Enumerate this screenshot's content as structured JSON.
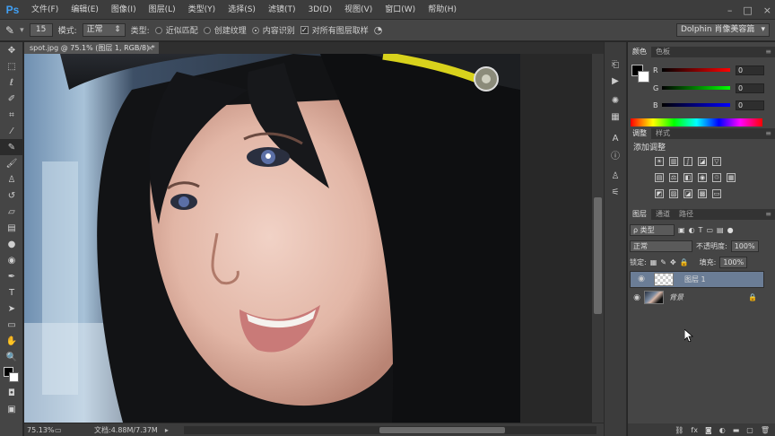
{
  "app": {
    "logo": "Ps"
  },
  "menu": [
    "文件(F)",
    "编辑(E)",
    "图像(I)",
    "图层(L)",
    "类型(Y)",
    "选择(S)",
    "滤镜(T)",
    "3D(D)",
    "视图(V)",
    "窗口(W)",
    "帮助(H)"
  ],
  "window_controls": [
    "–",
    "□",
    "×"
  ],
  "options": {
    "brush_size": "15",
    "mode_label": "模式:",
    "mode_value": "正常",
    "type_label": "类型:",
    "type_options": [
      {
        "label": "近似匹配",
        "selected": false
      },
      {
        "label": "创建纹理",
        "selected": false
      },
      {
        "label": "内容识别",
        "selected": true
      }
    ],
    "sample_all_label": "对所有图层取样",
    "sample_all_checked": true,
    "workspace": "Dolphin 肖像美容篇"
  },
  "document": {
    "tab_title": "spot.jpg @ 75.1% (图层 1, RGB/8) *",
    "close": "×"
  },
  "status": {
    "zoom": "75.13%",
    "doc_info": "文档:4.88M/7.37M"
  },
  "color_panel": {
    "tabs": [
      "颜色",
      "色板"
    ],
    "channels": [
      {
        "label": "R",
        "value": "0",
        "gradient": "linear-gradient(to right,#000,#f00)"
      },
      {
        "label": "G",
        "value": "0",
        "gradient": "linear-gradient(to right,#000,#0f0)"
      },
      {
        "label": "B",
        "value": "0",
        "gradient": "linear-gradient(to right,#000,#00f)"
      }
    ]
  },
  "adjust_panel": {
    "tabs": [
      "调整",
      "样式"
    ],
    "title": "添加调整"
  },
  "layers_panel": {
    "tabs": [
      "图层",
      "通道",
      "路径"
    ],
    "filter_label": "ρ 类型",
    "blend_mode": "正常",
    "opacity_label": "不透明度:",
    "opacity_value": "100%",
    "lock_label": "锁定:",
    "fill_label": "填充:",
    "fill_value": "100%",
    "layers": [
      {
        "name": "图层 1",
        "selected": true,
        "thumb": "transparent"
      },
      {
        "name": "背景",
        "selected": false,
        "thumb": "photo",
        "locked": true
      }
    ],
    "footer_icons": [
      "link-icon",
      "fx-icon",
      "mask-icon",
      "adjustment-icon",
      "folder-icon",
      "new-layer-icon",
      "trash-icon"
    ]
  },
  "colors": {
    "accent": "#41a0f5",
    "selected_layer": "#6b7d96"
  }
}
